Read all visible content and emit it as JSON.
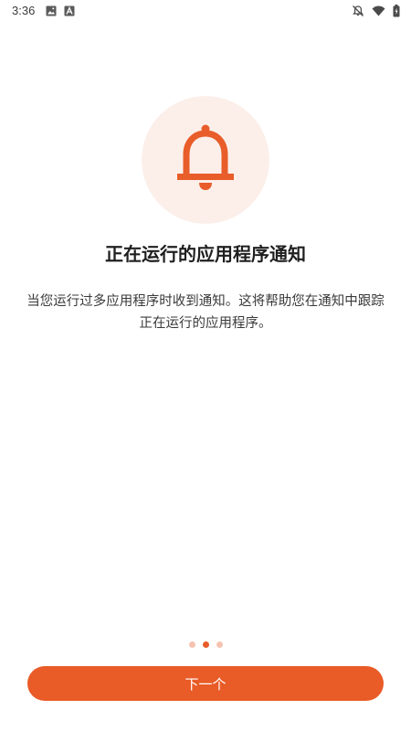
{
  "status_bar": {
    "time": "3:36",
    "icons": [
      "image-icon",
      "a-app-icon",
      "notifications-off-icon",
      "wifi-icon",
      "battery-charging-icon"
    ]
  },
  "hero": {
    "icon": "bell-icon",
    "circle_color": "#fcefea",
    "icon_color": "#e85d2a"
  },
  "title": "正在运行的应用程序通知",
  "description": "当您运行过多应用程序时收到通知。这将帮助您在通知中跟踪正在运行的应用程序。",
  "pager": {
    "count": 3,
    "active_index": 1,
    "active_color": "#e85d2a",
    "inactive_color": "#f6c3b0"
  },
  "next_button": {
    "label": "下一个",
    "color": "#e95b27"
  }
}
